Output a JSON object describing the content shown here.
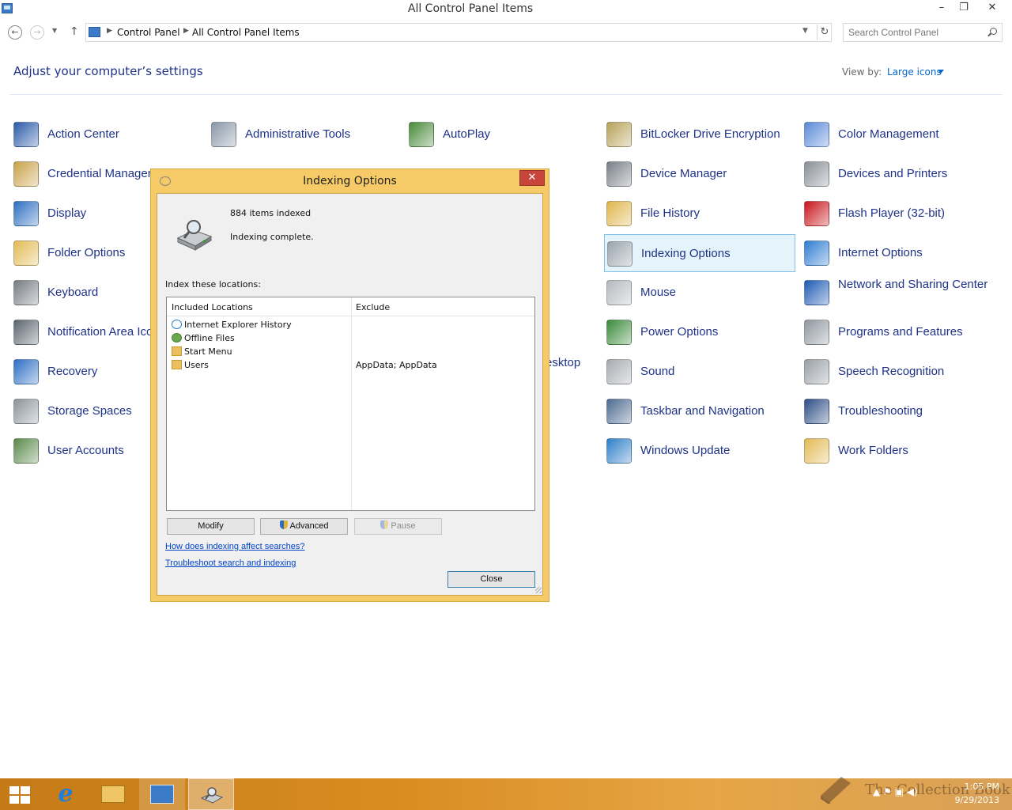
{
  "window": {
    "title": "All Control Panel Items",
    "minimize": "–",
    "maximize": "❐",
    "close": "✕"
  },
  "nav": {
    "back": "←",
    "forward": "→",
    "up": "↑",
    "breadcrumb": [
      "Control Panel",
      "All Control Panel Items"
    ],
    "refresh": "↻",
    "search_placeholder": "Search Control Panel"
  },
  "header": {
    "heading": "Adjust your computer’s settings",
    "view_by_label": "View by:",
    "view_by_value": "Large icons"
  },
  "items": [
    {
      "label": "Action Center",
      "icon": "flag-icon"
    },
    {
      "label": "Administrative Tools",
      "icon": "admin-tools-icon"
    },
    {
      "label": "AutoPlay",
      "icon": "autoplay-icon"
    },
    {
      "label": "BitLocker Drive Encryption",
      "icon": "bitlocker-icon"
    },
    {
      "label": "Color Management",
      "icon": "color-management-icon"
    },
    {
      "label": "Credential Manager",
      "icon": "credential-icon"
    },
    {
      "label": "Device Manager",
      "icon": "device-manager-icon"
    },
    {
      "label": "Devices and Printers",
      "icon": "printer-icon"
    },
    {
      "label": "Display",
      "icon": "display-icon"
    },
    {
      "label": "File History",
      "icon": "file-history-icon"
    },
    {
      "label": "Flash Player (32-bit)",
      "icon": "flash-icon"
    },
    {
      "label": "Folder Options",
      "icon": "folder-options-icon"
    },
    {
      "label": "Indexing Options",
      "icon": "indexing-icon"
    },
    {
      "label": "Internet Options",
      "icon": "internet-options-icon"
    },
    {
      "label": "Keyboard",
      "icon": "keyboard-icon"
    },
    {
      "label": "Mouse",
      "icon": "mouse-icon"
    },
    {
      "label": "Network and Sharing Center",
      "icon": "network-icon"
    },
    {
      "label": "Notification Area Icons",
      "icon": "notification-icon"
    },
    {
      "label": "Power Options",
      "icon": "power-icon"
    },
    {
      "label": "Programs and Features",
      "icon": "programs-icon"
    },
    {
      "label": "Recovery",
      "icon": "recovery-icon"
    },
    {
      "label": "Sound",
      "icon": "sound-icon"
    },
    {
      "label": "Speech Recognition",
      "icon": "microphone-icon"
    },
    {
      "label": "Storage Spaces",
      "icon": "storage-icon"
    },
    {
      "label": "Taskbar and Navigation",
      "icon": "taskbar-icon"
    },
    {
      "label": "Troubleshooting",
      "icon": "troubleshooting-icon"
    },
    {
      "label": "User Accounts",
      "icon": "users-icon"
    },
    {
      "label": "Windows Update",
      "icon": "update-icon"
    },
    {
      "label": "Work Folders",
      "icon": "work-folders-icon"
    }
  ],
  "partial": {
    "desktop_fragment": "esktop"
  },
  "dialog": {
    "title": "Indexing Options",
    "close": "✕",
    "count": "884 items indexed",
    "status": "Indexing complete.",
    "index_label": "Index these locations:",
    "columns": [
      "Included Locations",
      "Exclude"
    ],
    "rows": [
      {
        "location": "Internet Explorer History",
        "exclude": "",
        "icon": "ie-icon"
      },
      {
        "location": "Offline Files",
        "exclude": "",
        "icon": "offline-files-icon"
      },
      {
        "location": "Start Menu",
        "exclude": "",
        "icon": "folder-icon"
      },
      {
        "location": "Users",
        "exclude": "AppData; AppData",
        "icon": "folder-icon"
      }
    ],
    "buttons": {
      "modify": "Modify",
      "advanced": "Advanced",
      "pause": "Pause",
      "close": "Close"
    },
    "links": {
      "how": "How does indexing affect searches?",
      "troubleshoot": "Troubleshoot search and indexing"
    }
  },
  "taskbar": {
    "tray_text": "▲ ⚑ ▣ ◀)",
    "watermark": "The Collection Book",
    "time": "1:05 PM",
    "date": "9/29/2013"
  }
}
